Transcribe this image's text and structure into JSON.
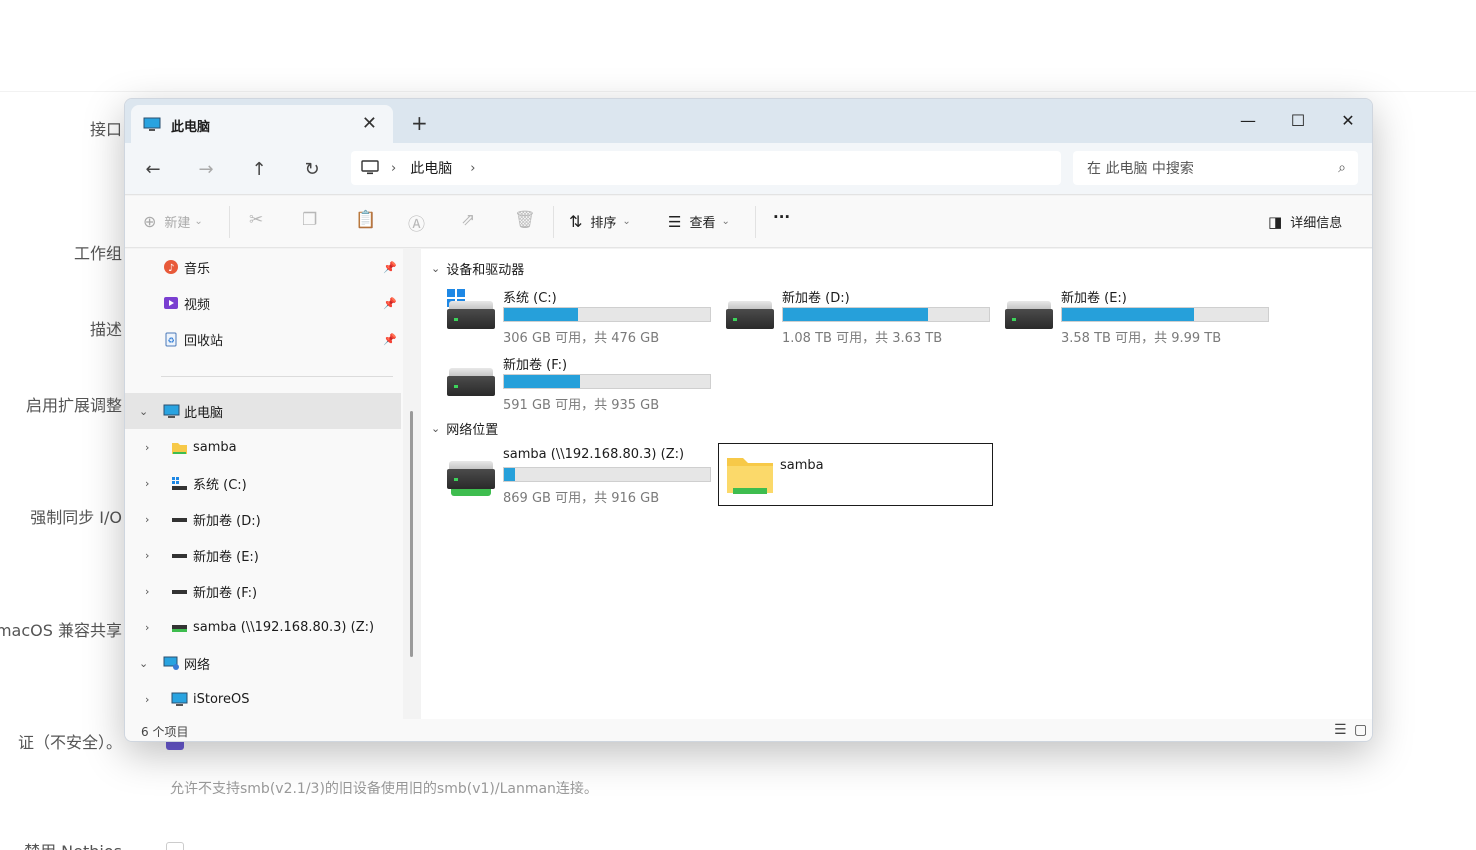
{
  "background": {
    "labels": [
      "接口",
      "工作组",
      "描述",
      "启用扩展调整",
      "强制同步 I/O",
      "macOS 兼容共享",
      "证（不安全）。",
      "禁用 Netbios"
    ],
    "hint": "允许不支持smb(v2.1/3)的旧设备使用旧的smb(v1)/Lanman连接。"
  },
  "window": {
    "tab_title": "此电脑",
    "new_tab": "+",
    "controls": {
      "minimize": "—",
      "maximize": "☐",
      "close": "✕"
    },
    "address": {
      "crumb": "此电脑",
      "sep": "›"
    },
    "search_placeholder": "在 此电脑 中搜索"
  },
  "toolbar": {
    "new_label": "新建",
    "sort_label": "排序",
    "view_label": "查看",
    "more_label": "···",
    "details_label": "详细信息"
  },
  "sidebar": {
    "pinned": [
      {
        "label": "音乐"
      },
      {
        "label": "视频"
      },
      {
        "label": "回收站"
      }
    ],
    "tree": [
      {
        "label": "此电脑",
        "expanded": true
      },
      {
        "label": "samba"
      },
      {
        "label": "系统 (C:)"
      },
      {
        "label": "新加卷 (D:)"
      },
      {
        "label": "新加卷 (E:)"
      },
      {
        "label": "新加卷 (F:)"
      },
      {
        "label": "samba (\\\\192.168.80.3) (Z:)"
      },
      {
        "label": "网络",
        "expanded": true
      },
      {
        "label": "iStoreOS"
      }
    ]
  },
  "content": {
    "devices_header": "设备和驱动器",
    "network_header": "网络位置",
    "drives": [
      {
        "name": "系统 (C:)",
        "info": "306 GB 可用，共 476 GB",
        "used_fraction": 0.357
      },
      {
        "name": "新加卷 (D:)",
        "info": "1.08 TB 可用，共 3.63 TB",
        "used_fraction": 0.702
      },
      {
        "name": "新加卷 (E:)",
        "info": "3.58 TB 可用，共 9.99 TB",
        "used_fraction": 0.642
      },
      {
        "name": "新加卷 (F:)",
        "info": "591 GB 可用，共 935 GB",
        "used_fraction": 0.368
      }
    ],
    "network_drive": {
      "name": "samba (\\\\192.168.80.3) (Z:)",
      "info": "869 GB 可用，共 916 GB",
      "used_fraction": 0.051
    },
    "network_folder": {
      "name": "samba"
    }
  },
  "status": {
    "count": "6 个项目"
  },
  "colors": {
    "bar_fill": "#26a0da",
    "accent": "#1e88e5"
  }
}
